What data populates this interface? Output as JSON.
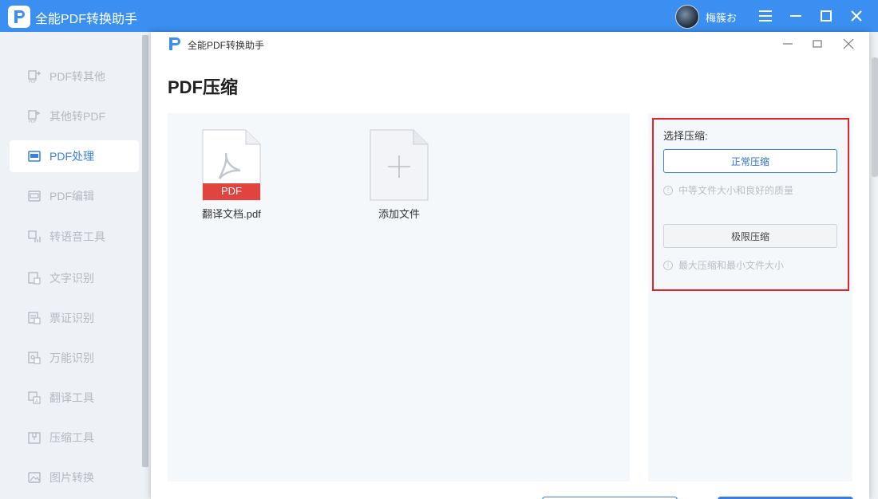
{
  "app": {
    "title": "全能PDF转换助手",
    "user_name": "梅簇お",
    "accent": "#3a8ff0"
  },
  "window_controls": [
    "menu-icon",
    "minimize-icon",
    "maximize-icon",
    "close-icon"
  ],
  "sidebar": {
    "items": [
      {
        "label": "PDF转其他",
        "icon": "pdf-export-icon",
        "active": false
      },
      {
        "label": "其他转PDF",
        "icon": "pdf-import-icon",
        "active": false
      },
      {
        "label": "PDF处理",
        "icon": "pdf-process-icon",
        "active": true
      },
      {
        "label": "PDF编辑",
        "icon": "pdf-edit-icon",
        "active": false
      },
      {
        "label": "转语音工具",
        "icon": "voice-icon",
        "active": false
      },
      {
        "label": "文字识别",
        "icon": "text-ocr-icon",
        "active": false
      },
      {
        "label": "票证识别",
        "icon": "ticket-ocr-icon",
        "active": false
      },
      {
        "label": "万能识别",
        "icon": "universal-ocr-icon",
        "active": false
      },
      {
        "label": "翻译工具",
        "icon": "translate-icon",
        "active": false
      },
      {
        "label": "压缩工具",
        "icon": "compress-icon",
        "active": false
      },
      {
        "label": "图片转换",
        "icon": "image-convert-icon",
        "active": false
      }
    ]
  },
  "dialog": {
    "title": "全能PDF转换助手",
    "page_title": "PDF压缩",
    "files": [
      {
        "name": "翻译文档.pdf",
        "badge": "PDF"
      },
      {
        "name": "添加文件"
      }
    ],
    "options": {
      "heading": "选择压缩:",
      "normal_label": "正常压缩",
      "normal_desc": "中等文件大小和良好的质量",
      "extreme_label": "极限压缩",
      "extreme_desc": "最大压缩和最小文件大小",
      "highlight_color": "#e0262b"
    }
  }
}
